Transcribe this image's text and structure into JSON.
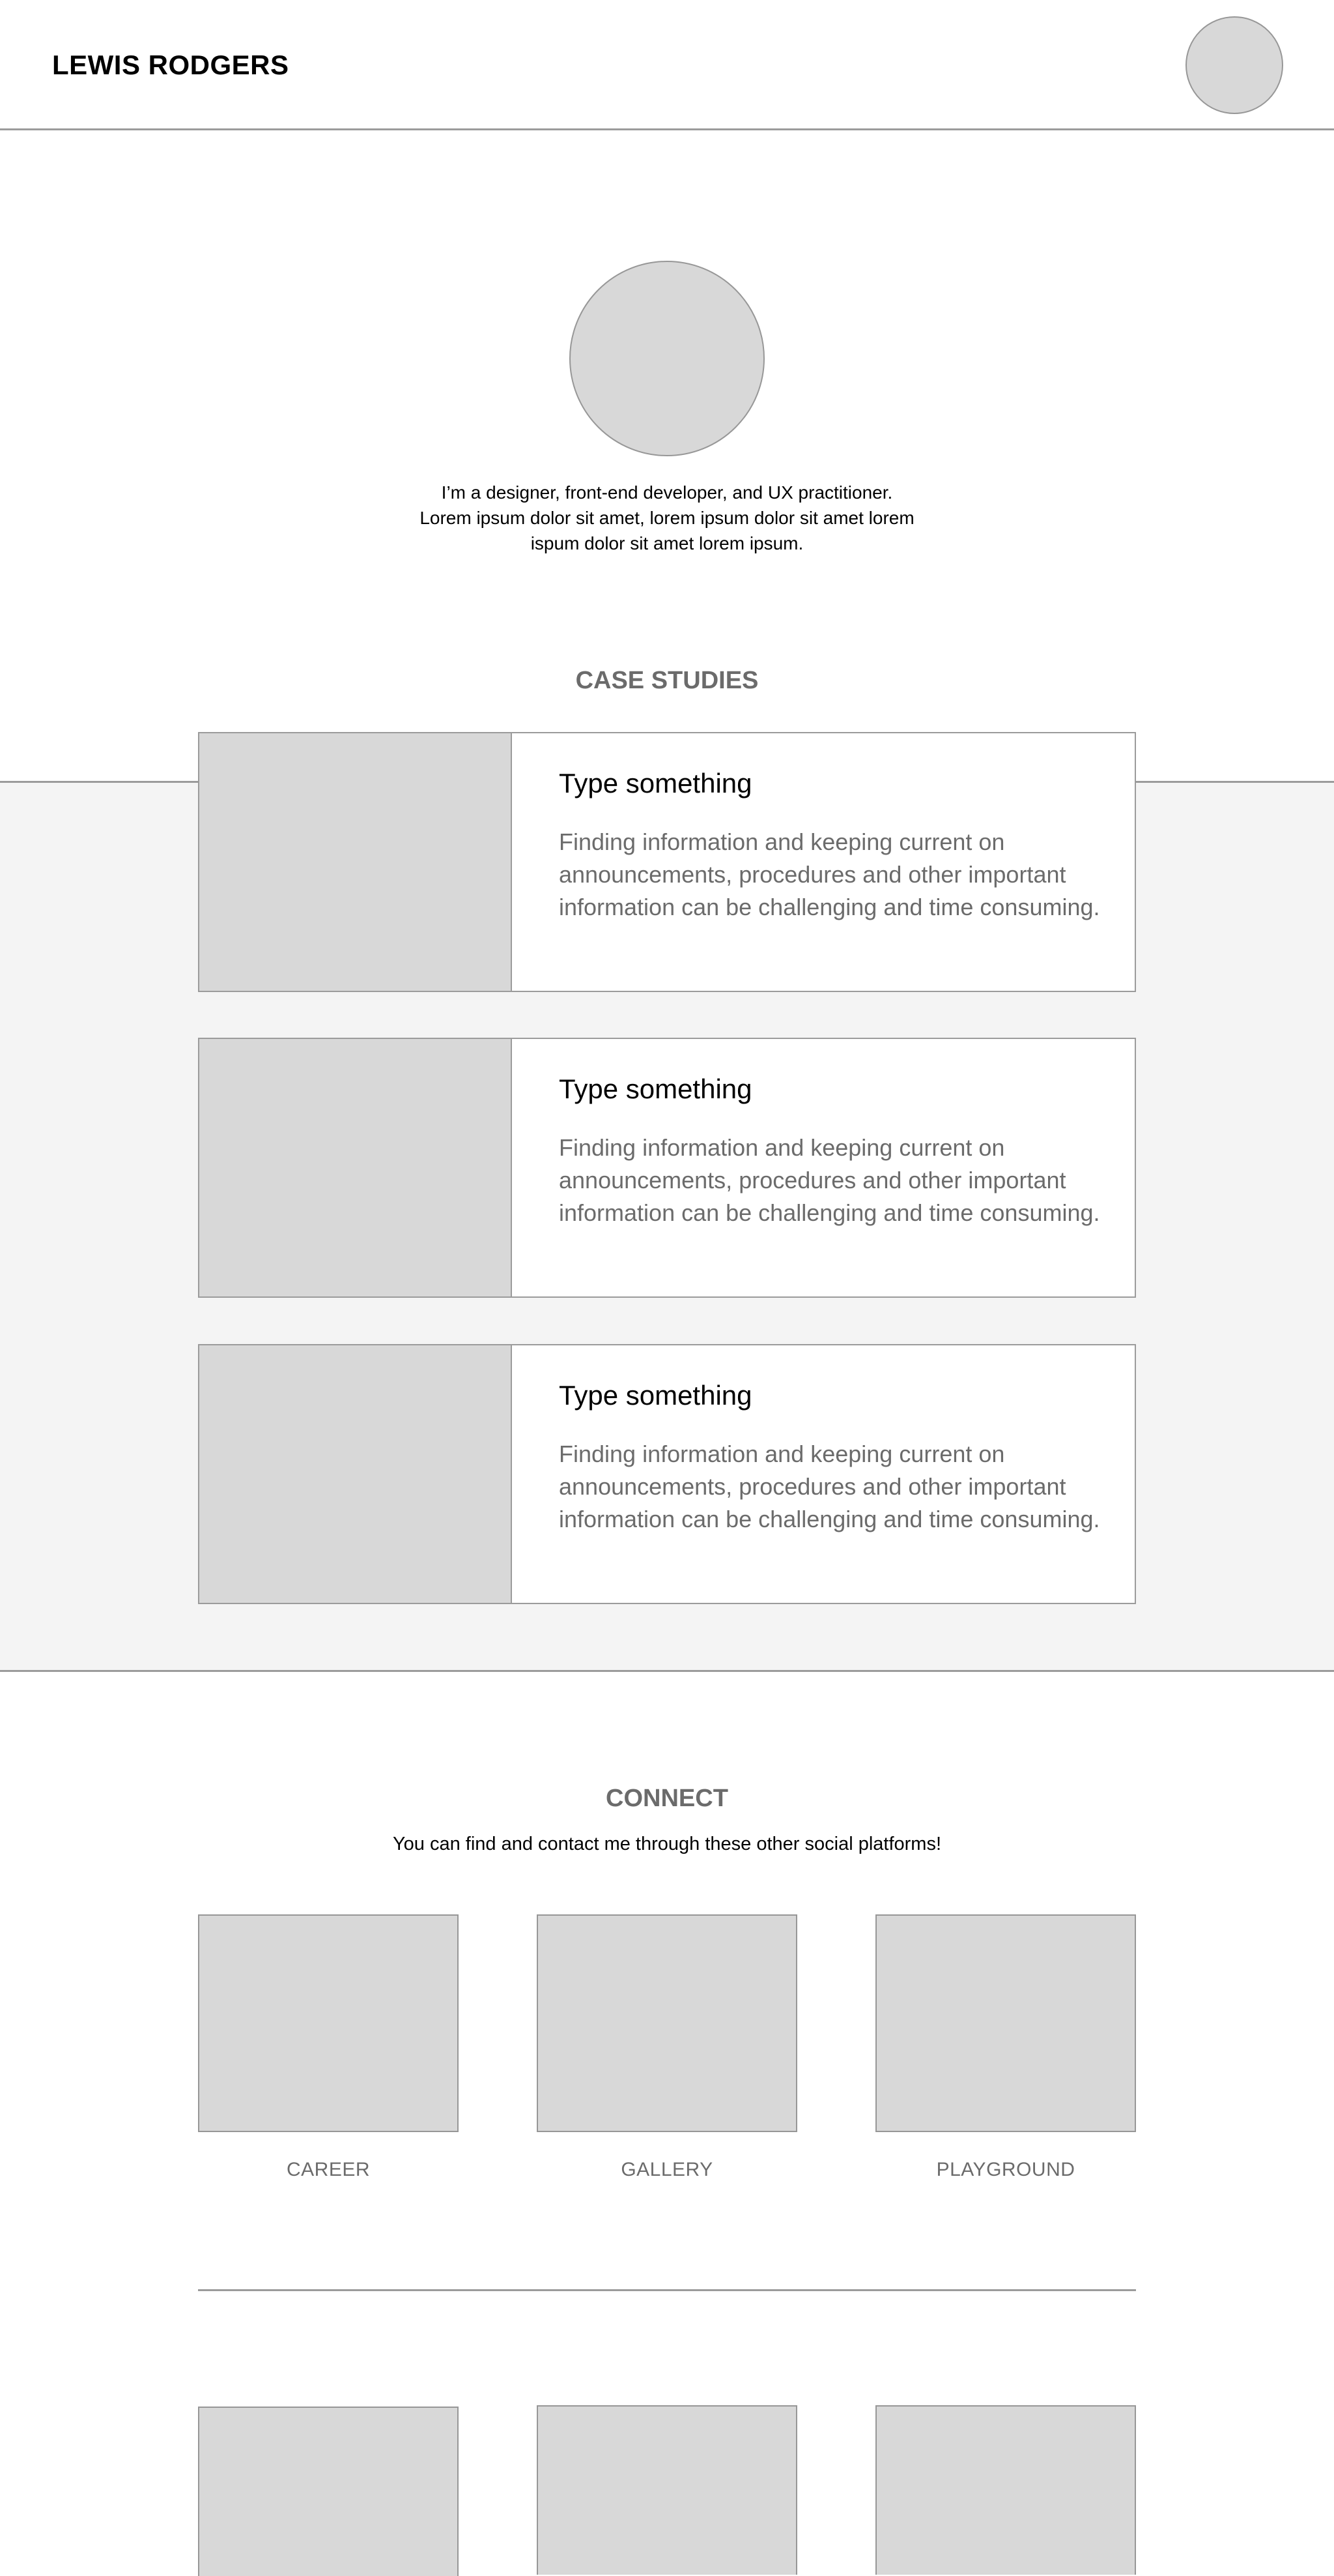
{
  "header": {
    "brand": "LEWIS RODGERS"
  },
  "intro": {
    "lines": [
      "I’m a designer, front-end developer, and UX practitioner.",
      "Lorem ipsum dolor sit amet, lorem ipsum dolor sit amet lorem",
      "ispum dolor sit amet lorem ipsum."
    ]
  },
  "case_studies": {
    "heading": "CASE STUDIES",
    "items": [
      {
        "title": "Type something",
        "description": "Finding information and keeping current on announcements, procedures and other important information can be challenging and time consuming."
      },
      {
        "title": "Type something",
        "description": "Finding information and keeping current on announcements, procedures and other important information can be challenging and time consuming."
      },
      {
        "title": "Type something",
        "description": "Finding information and keeping current on announcements, procedures and other important information can be challenging and time consuming."
      }
    ]
  },
  "connect": {
    "heading": "CONNECT",
    "subtitle": "You can find and contact me through these other social platforms!",
    "tiles": [
      {
        "label": "CAREER"
      },
      {
        "label": "GALLERY"
      },
      {
        "label": "PLAYGROUND"
      }
    ]
  },
  "colors": {
    "placeholder_fill": "#d8d8d8",
    "border": "#9b9b9b",
    "muted_text": "#6b6b6b",
    "band_background": "#f4f4f4"
  }
}
